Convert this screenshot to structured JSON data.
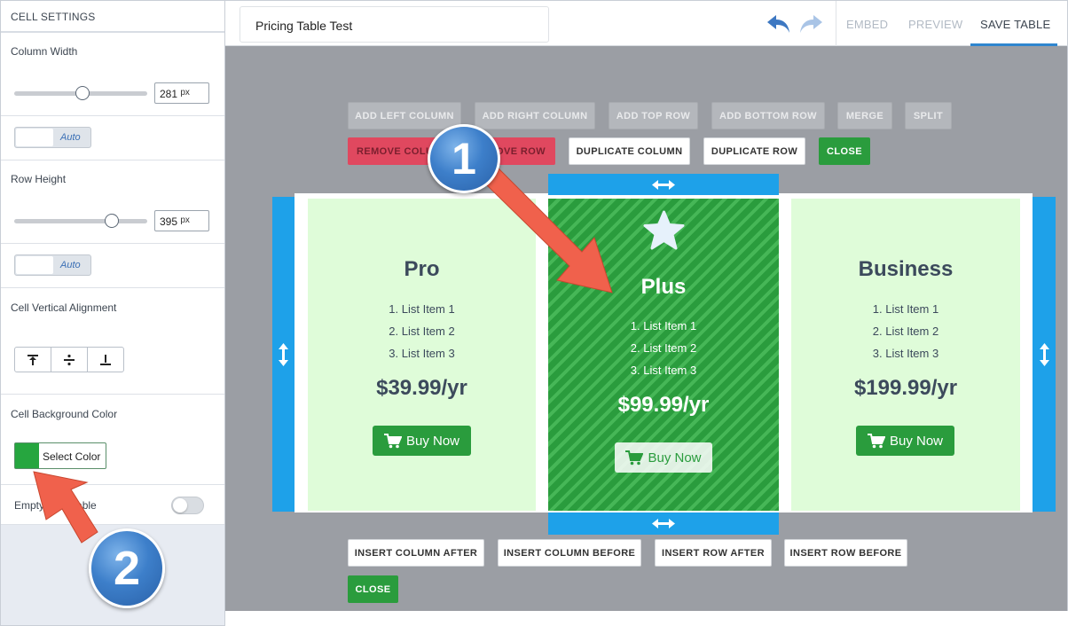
{
  "sidebar": {
    "header": "CELL SETTINGS",
    "column_width": {
      "label": "Column Width",
      "value": "281",
      "unit": "px",
      "slider_fraction": 0.51
    },
    "column_auto": "Auto",
    "row_height": {
      "label": "Row Height",
      "value": "395",
      "unit": "px",
      "slider_fraction": 0.73
    },
    "row_auto": "Auto",
    "valign_label": "Cell Vertical Alignment",
    "bg_color_label": "Cell Background Color",
    "bg_color_value": "#26a63f",
    "select_color": "Select Color",
    "empty_label": "Empty",
    "empty_label_tail": "able"
  },
  "topbar": {
    "title": "Pricing Table Test",
    "embed": "EMBED",
    "preview": "PREVIEW",
    "save": "SAVE TABLE"
  },
  "toolbar": {
    "row1": [
      "ADD LEFT COLUMN",
      "ADD RIGHT COLUMN",
      "ADD TOP ROW",
      "ADD BOTTOM ROW",
      "MERGE",
      "SPLIT"
    ],
    "remove_column": "REMOVE COLU",
    "remove_row": "OVE ROW",
    "duplicate_column": "DUPLICATE COLUMN",
    "duplicate_row": "DUPLICATE ROW",
    "close": "CLOSE"
  },
  "bottom_toolbar": {
    "insert_column_after": "INSERT COLUMN AFTER",
    "insert_column_before": "INSERT COLUMN BEFORE",
    "insert_row_after": "INSERT ROW AFTER",
    "insert_row_before": "INSERT ROW BEFORE",
    "close": "CLOSE"
  },
  "plans": [
    {
      "name": "Pro",
      "items": [
        "1. List Item 1",
        "2. List Item 2",
        "3. List Item 3"
      ],
      "price": "$39.99/yr",
      "button": "Buy Now"
    },
    {
      "name": "Plus",
      "items": [
        "1. List Item 1",
        "2. List Item 2",
        "3. List Item 3"
      ],
      "price": "$99.99/yr",
      "button": "Buy Now"
    },
    {
      "name": "Business",
      "items": [
        "1. List Item 1",
        "2. List Item 2",
        "3. List Item 3"
      ],
      "price": "$199.99/yr",
      "button": "Buy Now"
    }
  ],
  "annotations": {
    "badge1": "1",
    "badge2": "2"
  },
  "colors": {
    "accent_blue": "#1ea1e9",
    "green": "#2a9c3d",
    "light_green": "#dffcd9",
    "arrow_red": "#f0614c"
  }
}
